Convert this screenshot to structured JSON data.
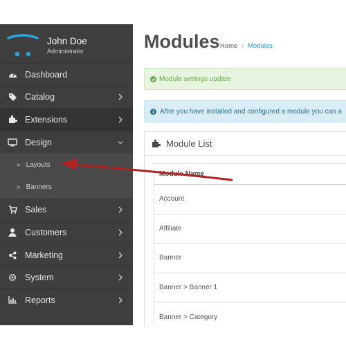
{
  "user": {
    "name": "John Doe",
    "role": "Administrator"
  },
  "sidebar": {
    "items": [
      {
        "label": "Dashboard",
        "icon": "dashboard-icon",
        "chevron": false
      },
      {
        "label": "Catalog",
        "icon": "tag-icon",
        "chevron": true
      },
      {
        "label": "Extensions",
        "icon": "puzzle-icon",
        "chevron": true,
        "active": true
      },
      {
        "label": "Design",
        "icon": "monitor-icon",
        "chevron": true,
        "expanded": true
      },
      {
        "label": "Sales",
        "icon": "cart-icon",
        "chevron": true
      },
      {
        "label": "Customers",
        "icon": "user-icon",
        "chevron": true
      },
      {
        "label": "Marketing",
        "icon": "share-icon",
        "chevron": true
      },
      {
        "label": "System",
        "icon": "gear-icon",
        "chevron": true
      },
      {
        "label": "Reports",
        "icon": "bar-chart-icon",
        "chevron": true
      }
    ],
    "design_sub": [
      {
        "label": "Layouts",
        "prefix": "»"
      },
      {
        "label": "Banners",
        "prefix": "»"
      }
    ]
  },
  "main": {
    "title": "Modules",
    "breadcrumb": {
      "home": "Home",
      "separator": "/",
      "current": "Modules"
    },
    "alert_success": "Module settings update",
    "alert_info": "After you have installed and configured a module you can a",
    "panel_title": "Module List",
    "table": {
      "header": "Module Name",
      "rows": [
        "Account",
        "Affiliate",
        "Banner",
        "Banner > Banner 1",
        "Banner > Category"
      ]
    }
  },
  "colors": {
    "sidebar_bg": "#3e3e3e",
    "accent_blue": "#1e91cf",
    "success_text": "#6aa84f",
    "info_bg": "#d9edf7",
    "arrow_red": "#b22222"
  }
}
